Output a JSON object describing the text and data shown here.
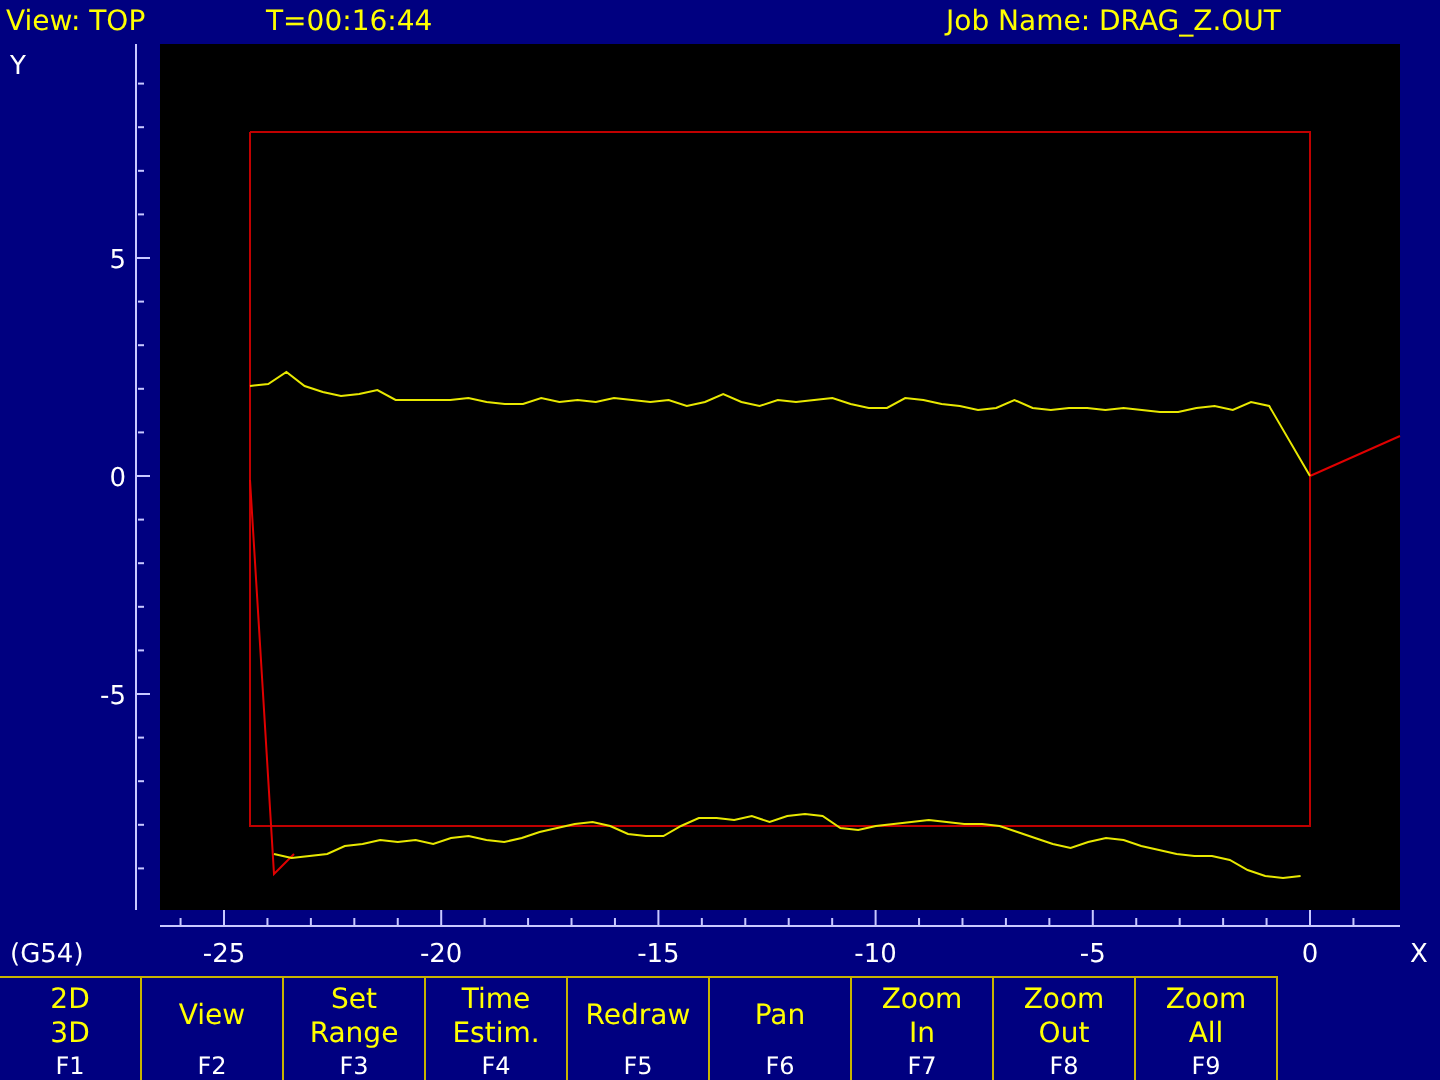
{
  "status_bar": {
    "view": "View: TOP",
    "time": "T=00:16:44",
    "job": "Job Name: DRAG_Z.OUT"
  },
  "plot": {
    "y_axis_label": "Y",
    "x_axis_label": "X",
    "coordinate_system": "(G54)",
    "y_ticks": [
      "5",
      "0",
      "-5"
    ],
    "x_ticks": [
      "-25",
      "-20",
      "-15",
      "-10",
      "-5",
      "0"
    ]
  },
  "function_keys": [
    {
      "label": "2D\n3D",
      "key": "F1"
    },
    {
      "label": "View",
      "key": "F2"
    },
    {
      "label": "Set\nRange",
      "key": "F3"
    },
    {
      "label": "Time\nEstim.",
      "key": "F4"
    },
    {
      "label": "Redraw",
      "key": "F5"
    },
    {
      "label": "Pan",
      "key": "F6"
    },
    {
      "label": "Zoom\nIn",
      "key": "F7"
    },
    {
      "label": "Zoom\nOut",
      "key": "F8"
    },
    {
      "label": "Zoom\nAll",
      "key": "F9"
    }
  ]
}
